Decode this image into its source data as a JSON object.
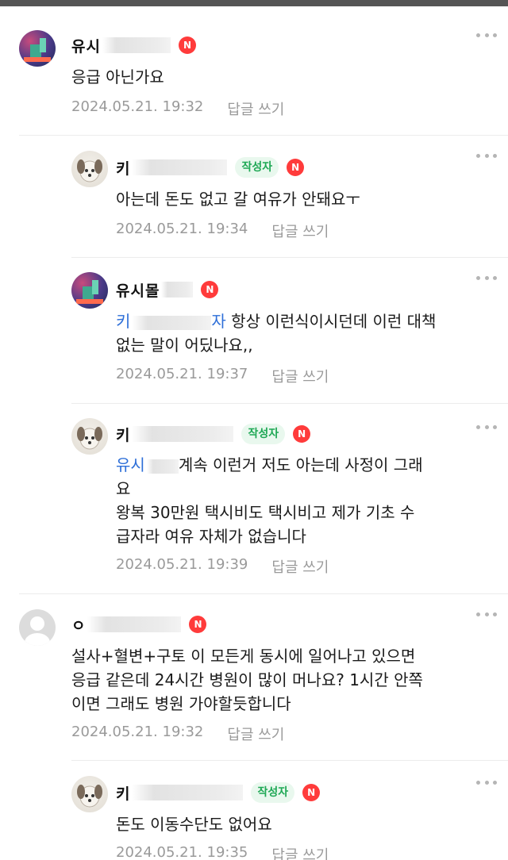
{
  "badges": {
    "author": "작성자",
    "new": "N"
  },
  "reply_label": "답글 쓰기",
  "comments": [
    {
      "nick": "유시",
      "body": [
        "응급 아닌가요"
      ],
      "time": "2024.05.21. 19:32"
    },
    {
      "nick": "키",
      "body": [
        "아는데 돈도 없고 갈 여유가 안돼요ㅜ"
      ],
      "time": "2024.05.21. 19:34"
    },
    {
      "nick": "유시몰",
      "mention": "키",
      "mention_tail": "자",
      "body": [
        " 항상 이런식이시던데 이런 대책",
        "없는 말이 어딨나요,,"
      ],
      "time": "2024.05.21. 19:37"
    },
    {
      "nick": "키",
      "mention": "유시",
      "body": [
        "계속 이런거 저도 아는데 사정이 그래",
        "요",
        "왕복 30만원 택시비도 택시비고 제가 기초 수",
        "급자라 여유 자체가 없습니다"
      ],
      "time": "2024.05.21. 19:39"
    },
    {
      "nick": "ㅇ",
      "body": [
        "설사+혈변+구토 이 모든게 동시에 일어나고 있으면",
        "응급 같은데 24시간 병원이 많이 머나요? 1시간 안쪽",
        "이면 그래도 병원 가야할듯합니다"
      ],
      "time": "2024.05.21. 19:32"
    },
    {
      "nick": "키",
      "body": [
        "돈도 이동수단도 없어요"
      ],
      "time": "2024.05.21. 19:35"
    }
  ]
}
